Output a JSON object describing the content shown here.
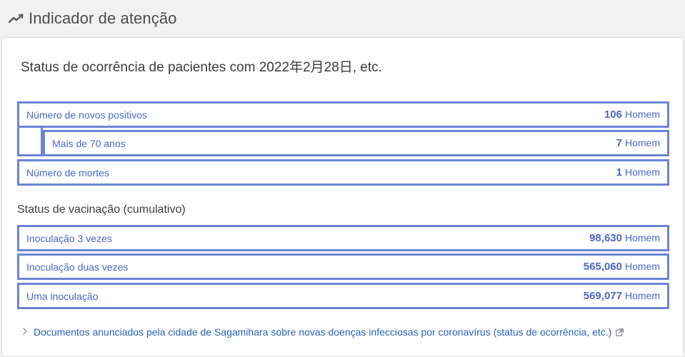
{
  "header": {
    "title": "Indicador de atenção",
    "icon": "trend-line-icon"
  },
  "card": {
    "title": "Status de ocorrência de pacientes com 2022年2月28日, etc.",
    "patients": [
      {
        "label": "Número de novos positivos",
        "value": "106",
        "unit": "Homem"
      },
      {
        "label": "Mais de 70 anos",
        "value": "7",
        "unit": "Homem"
      },
      {
        "label": "Número de mortes",
        "value": "1",
        "unit": "Homem"
      }
    ],
    "vaccination_title": "Status de vacinação (cumulativo)",
    "vaccination": [
      {
        "label": "Inoculação 3 vezes",
        "value": "98,630",
        "unit": "Homem"
      },
      {
        "label": "Inoculação duas vezes",
        "value": "565,060",
        "unit": "Homem"
      },
      {
        "label": "Uma inoculação",
        "value": "569,077",
        "unit": "Homem"
      }
    ],
    "link_text": "Documentos anunciados pela cidade de Sagamihara sobre novas doenças infecciosas por coronavírus (status de ocorrência, etc.)"
  },
  "colors": {
    "accent": "#6b84d6",
    "text_blue": "#4a67c7",
    "link": "#2a62b5",
    "background": "#f1f1f2"
  }
}
